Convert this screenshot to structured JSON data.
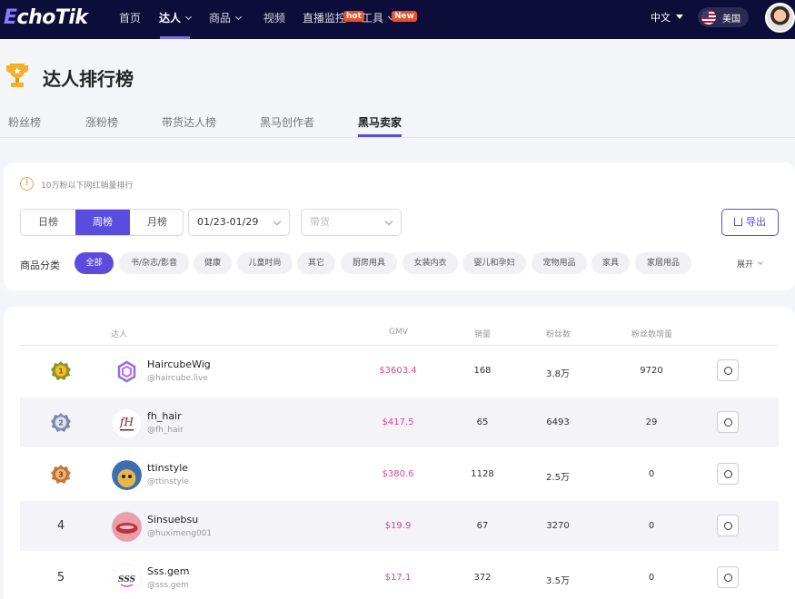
{
  "nav": {
    "logo_e": "E",
    "logo_rest": "choTik",
    "items": [
      {
        "label": "首页"
      },
      {
        "label": "达人"
      },
      {
        "label": "商品"
      },
      {
        "label": "视频"
      },
      {
        "label": "直播监控"
      },
      {
        "label": "工具"
      }
    ],
    "hot_tag": "hot",
    "new_tag": "New",
    "language": "中文",
    "region": "美国"
  },
  "page": {
    "title": "达人排行榜",
    "tabs": [
      "粉丝榜",
      "涨粉榜",
      "带货达人榜",
      "黑马创作者",
      "黑马卖家"
    ],
    "active_tab": "黑马卖家"
  },
  "filters": {
    "info": "10万粉以下网红销量排行",
    "period": [
      "日榜",
      "周榜",
      "月榜"
    ],
    "active_period": "周榜",
    "date_range": "01/23-01/29",
    "type_placeholder": "带货",
    "export": "导出",
    "category_label": "商品分类",
    "categories": [
      "全部",
      "书/杂志/影音",
      "健康",
      "儿童时尚",
      "其它",
      "厨房用具",
      "女装内衣",
      "婴儿和孕妇",
      "宠物用品",
      "家具",
      "家居用品"
    ],
    "active_category": "全部",
    "expand": "展开"
  },
  "table": {
    "headers": {
      "creator": "达人",
      "gmv": "GMV",
      "sales": "销量",
      "fans": "粉丝数",
      "fans_growth": "粉丝数增量"
    },
    "rows": [
      {
        "rank": "1",
        "medal": "gold",
        "name": "HaircubeWig",
        "handle": "@haircube.live",
        "gmv": "$3603.4",
        "sales": "168",
        "fans": "3.8万",
        "fans_growth": "9720"
      },
      {
        "rank": "2",
        "medal": "silver",
        "name": "fh_hair",
        "handle": "@fh_hair",
        "gmv": "$417.5",
        "sales": "65",
        "fans": "6493",
        "fans_growth": "29"
      },
      {
        "rank": "3",
        "medal": "bronze",
        "name": "ttinstyle",
        "handle": "@ttinstyle",
        "gmv": "$380.6",
        "sales": "1128",
        "fans": "2.5万",
        "fans_growth": "0"
      },
      {
        "rank": "4",
        "medal": "",
        "name": "Sinsuebsu",
        "handle": "@huximeng001",
        "gmv": "$19.9",
        "sales": "67",
        "fans": "3270",
        "fans_growth": "0"
      },
      {
        "rank": "5",
        "medal": "",
        "name": "Sss.gem",
        "handle": "@sss.gem",
        "gmv": "$17.1",
        "sales": "372",
        "fans": "3.5万",
        "fans_growth": "0"
      }
    ]
  },
  "colors": {
    "nav_bg": "#0d0d3a",
    "accent": "#5b4ce0",
    "gmv": "#d9478f",
    "hot": "#e8512c"
  }
}
